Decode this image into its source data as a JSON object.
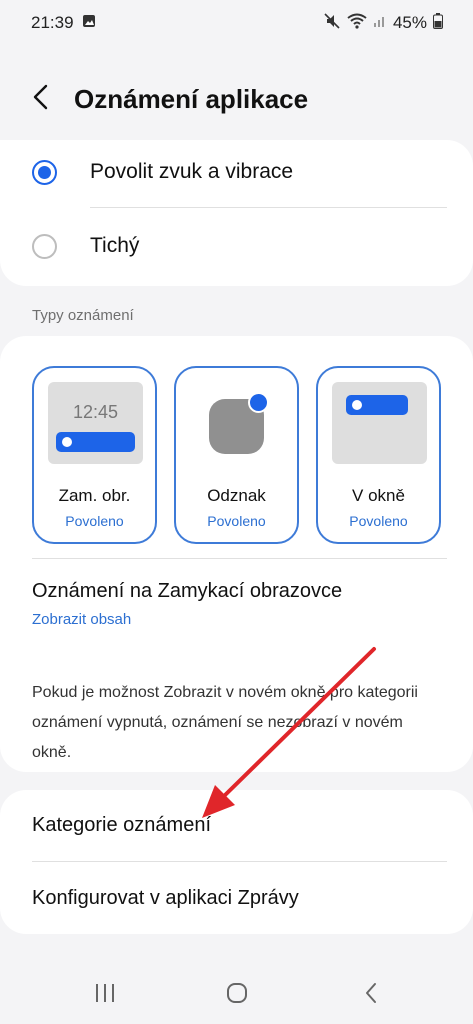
{
  "status": {
    "time": "21:39",
    "battery": "45%",
    "icons": [
      "gallery-icon",
      "mute-icon",
      "wifi-icon",
      "signal-icon",
      "battery-icon"
    ]
  },
  "header": {
    "title": "Oznámení aplikace",
    "back_icon": "chevron-left-icon"
  },
  "sound_options": [
    {
      "label": "Povolit zvuk a vibrace",
      "selected": true
    },
    {
      "label": "Tichý",
      "selected": false
    }
  ],
  "types_section": {
    "label": "Typy oznámení",
    "tiles": [
      {
        "label": "Zam. obr.",
        "status": "Povoleno",
        "preview_time": "12:45"
      },
      {
        "label": "Odznak",
        "status": "Povoleno"
      },
      {
        "label": "V okně",
        "status": "Povoleno"
      }
    ]
  },
  "lock_screen": {
    "title": "Oznámení na Zamykací obrazovce",
    "value": "Zobrazit obsah"
  },
  "info_text": "Pokud je možnost Zobrazit v novém okně pro kategorii oznámení vypnutá, oznámení se nezobrazí v novém okně.",
  "list": {
    "categories": "Kategorie oznámení",
    "configure": "Konfigurovat v aplikaci Zprávy"
  },
  "nav": {
    "icons": [
      "recents-icon",
      "home-icon",
      "back-icon"
    ]
  },
  "colors": {
    "accent": "#1d64e8",
    "status_text": "#2c6fd1",
    "annotation_arrow": "#e0262a"
  }
}
